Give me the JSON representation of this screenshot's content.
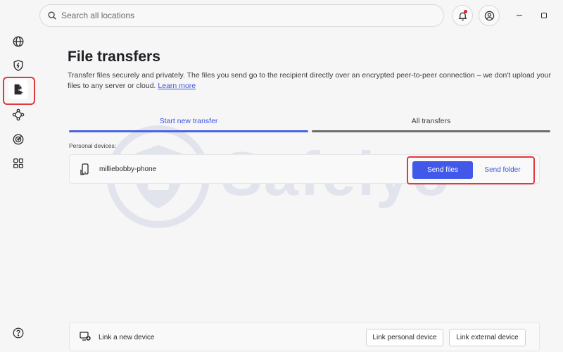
{
  "search": {
    "placeholder": "Search all locations"
  },
  "sidebar": {
    "items": [
      {
        "icon": "globe-icon"
      },
      {
        "icon": "shield-bolt-icon"
      },
      {
        "icon": "file-transfer-icon",
        "active": true
      },
      {
        "icon": "mesh-network-icon"
      },
      {
        "icon": "target-icon"
      },
      {
        "icon": "apps-grid-icon"
      }
    ],
    "help_icon": "help-icon"
  },
  "page": {
    "title": "File transfers",
    "description": "Transfer files securely and privately. The files you send go to the recipient directly over an encrypted peer-to-peer connection – we don't upload your files to any server or cloud.",
    "learn_more": "Learn more"
  },
  "tabs": [
    {
      "label": "Start new transfer",
      "active": true
    },
    {
      "label": "All transfers",
      "active": false
    }
  ],
  "devices": {
    "section_label": "Personal devices:",
    "items": [
      {
        "name": "milliebobby-phone",
        "send_files": "Send files",
        "send_folder": "Send folder"
      }
    ]
  },
  "link_device": {
    "label": "Link a new device",
    "personal_button": "Link personal device",
    "external_button": "Link external device"
  },
  "watermark": {
    "text": "Safelyo"
  },
  "colors": {
    "accent": "#4158e8",
    "highlight": "#e0393e",
    "link": "#3b55d9"
  }
}
